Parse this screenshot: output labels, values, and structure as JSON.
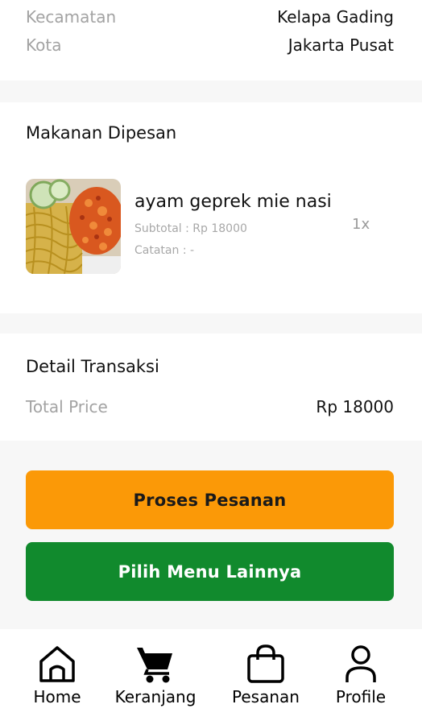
{
  "address": {
    "kecamatan_label": "Kecamatan",
    "kecamatan_value": "Kelapa Gading",
    "kota_label": "Kota",
    "kota_value": "Jakarta Pusat"
  },
  "order": {
    "section_title": "Makanan Dipesan",
    "items": [
      {
        "name": "ayam geprek mie nasi",
        "subtotal": "Subtotal : Rp 18000",
        "note": "Catatan : -",
        "qty": "1x",
        "image_icon": "food-photo"
      }
    ]
  },
  "transaction": {
    "section_title": "Detail Transaksi",
    "total_label": "Total Price",
    "total_value": "Rp 18000"
  },
  "actions": {
    "process_label": "Proses Pesanan",
    "more_menu_label": "Pilih Menu Lainnya"
  },
  "nav": {
    "items": [
      {
        "label": "Home",
        "icon": "home-icon"
      },
      {
        "label": "Keranjang",
        "icon": "cart-icon"
      },
      {
        "label": "Pesanan",
        "icon": "shopping-bag-icon"
      },
      {
        "label": "Profile",
        "icon": "user-icon"
      }
    ]
  },
  "colors": {
    "accent_orange": "#fb9907",
    "accent_green": "#118a2d",
    "background": "#f7f7f7"
  }
}
